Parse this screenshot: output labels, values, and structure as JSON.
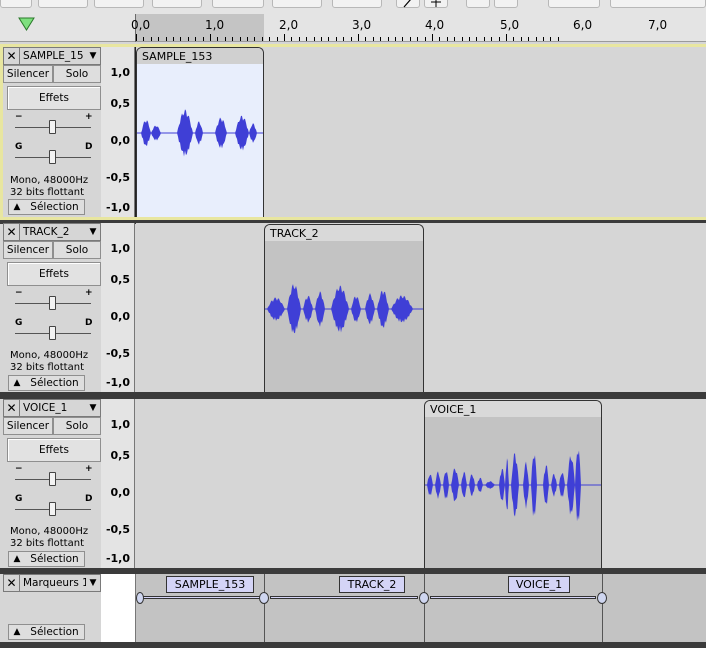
{
  "ruler": {
    "ticks": [
      "0,0",
      "1,0",
      "2,0",
      "3,0",
      "4,0",
      "5,0",
      "6,0",
      "7,0"
    ]
  },
  "controls": {
    "mute_label": "Silencer",
    "solo_label": "Solo",
    "effects_label": "Effets",
    "gain_minus": "−",
    "gain_plus": "+",
    "pan_left": "G",
    "pan_right": "D",
    "info_line1": "Mono, 48000Hz",
    "info_line2": "32 bits flottant",
    "select_label": "Sélection",
    "close_glyph": "✕",
    "dropdown_glyph": "▼",
    "collapse_glyph": "▲"
  },
  "vruler": [
    "1,0",
    "0,5",
    "0,0",
    "-0,5",
    "-1,0"
  ],
  "tracks": [
    {
      "name": "SAMPLE_15",
      "clip_name": "SAMPLE_153"
    },
    {
      "name": "TRACK_2",
      "clip_name": "TRACK_2"
    },
    {
      "name": "VOICE_1",
      "clip_name": "VOICE_1"
    }
  ],
  "label_track": {
    "name": "Marqueurs 1",
    "labels": [
      "SAMPLE_153",
      "TRACK_2",
      "VOICE_1"
    ]
  },
  "colors": {
    "waveform": "#3f3fd6",
    "selected_clip": "#e8eefc",
    "clip": "#c3c3c3",
    "label_fill": "#d4d4f6"
  },
  "icons": [
    "play-triangle-icon",
    "draw-tool-icon",
    "multi-tool-icon",
    "zoom-icon",
    "undo-icon",
    "close-icon",
    "dropdown-arrow-icon",
    "collapse-icon"
  ]
}
